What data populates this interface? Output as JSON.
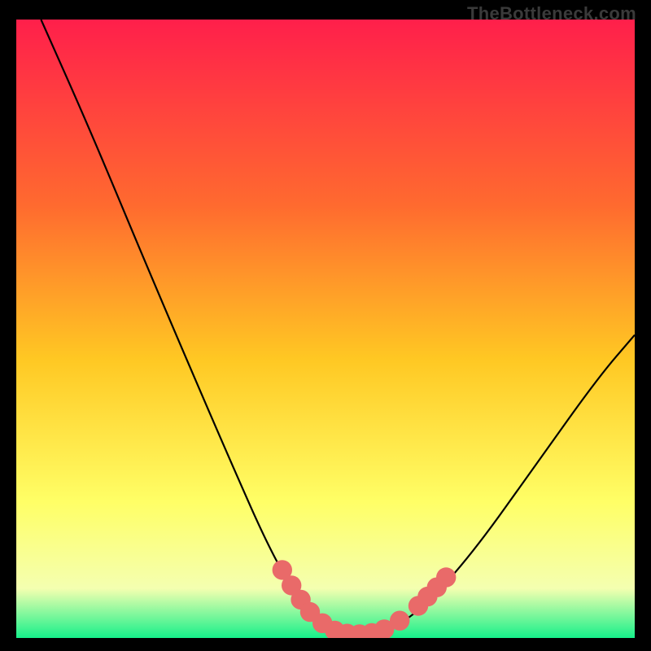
{
  "watermark": "TheBottleneck.com",
  "colors": {
    "gradient_top": "#ff1f4b",
    "gradient_upper": "#ff6a2f",
    "gradient_mid": "#ffc823",
    "gradient_lower": "#ffff66",
    "gradient_pale": "#f4ffb0",
    "gradient_green": "#16f08a",
    "curve": "#000000",
    "dots": "#e96a69",
    "frame": "#000000"
  },
  "chart_data": {
    "type": "line",
    "title": "",
    "xlabel": "",
    "ylabel": "",
    "xlim": [
      0,
      100
    ],
    "ylim": [
      0,
      100
    ],
    "background_gradient": {
      "orientation": "vertical",
      "stops": [
        {
          "offset": 0.0,
          "color_key": "gradient_top"
        },
        {
          "offset": 0.3,
          "color_key": "gradient_upper"
        },
        {
          "offset": 0.55,
          "color_key": "gradient_mid"
        },
        {
          "offset": 0.78,
          "color_key": "gradient_lower"
        },
        {
          "offset": 0.92,
          "color_key": "gradient_pale"
        },
        {
          "offset": 1.0,
          "color_key": "gradient_green"
        }
      ]
    },
    "series": [
      {
        "name": "bottleneck-curve",
        "stroke_key": "curve",
        "path": [
          {
            "x": 4,
            "y": 100
          },
          {
            "x": 12,
            "y": 82
          },
          {
            "x": 22,
            "y": 58
          },
          {
            "x": 34,
            "y": 30
          },
          {
            "x": 42,
            "y": 12
          },
          {
            "x": 48,
            "y": 3
          },
          {
            "x": 54,
            "y": 0.5
          },
          {
            "x": 60,
            "y": 1
          },
          {
            "x": 66,
            "y": 5
          },
          {
            "x": 74,
            "y": 14
          },
          {
            "x": 84,
            "y": 28
          },
          {
            "x": 94,
            "y": 42
          },
          {
            "x": 100,
            "y": 49
          }
        ]
      }
    ],
    "highlight_dots": [
      {
        "x": 43,
        "y": 11,
        "r": 1.6
      },
      {
        "x": 44.5,
        "y": 8.5,
        "r": 1.6
      },
      {
        "x": 46,
        "y": 6.2,
        "r": 1.6
      },
      {
        "x": 47.5,
        "y": 4.2,
        "r": 1.6
      },
      {
        "x": 49.5,
        "y": 2.4,
        "r": 1.6
      },
      {
        "x": 51.5,
        "y": 1.2,
        "r": 1.6
      },
      {
        "x": 53.5,
        "y": 0.7,
        "r": 1.6
      },
      {
        "x": 55.5,
        "y": 0.6,
        "r": 1.6
      },
      {
        "x": 57.5,
        "y": 0.8,
        "r": 1.6
      },
      {
        "x": 59.5,
        "y": 1.4,
        "r": 1.6
      },
      {
        "x": 62,
        "y": 2.8,
        "r": 1.6
      },
      {
        "x": 65,
        "y": 5.2,
        "r": 1.6
      },
      {
        "x": 66.5,
        "y": 6.7,
        "r": 1.6
      },
      {
        "x": 68,
        "y": 8.2,
        "r": 1.6
      },
      {
        "x": 69.5,
        "y": 9.8,
        "r": 1.6
      }
    ]
  }
}
